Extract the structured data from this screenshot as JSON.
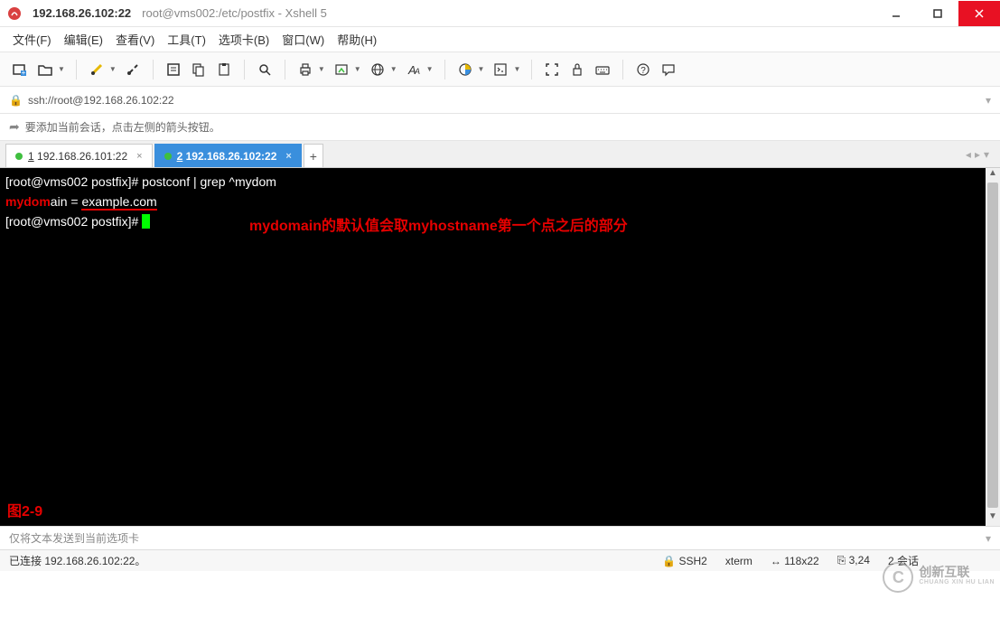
{
  "title": {
    "main": "192.168.26.102:22",
    "sub": "root@vms002:/etc/postfix - Xshell 5"
  },
  "menu": {
    "file": "文件(F)",
    "edit": "编辑(E)",
    "view": "查看(V)",
    "tools": "工具(T)",
    "tabs": "选项卡(B)",
    "window": "窗口(W)",
    "help": "帮助(H)"
  },
  "address": "ssh://root@192.168.26.102:22",
  "hint": "要添加当前会话，点击左侧的箭头按钮。",
  "tabs": {
    "items": [
      {
        "num": "1",
        "label": "192.168.26.101:22"
      },
      {
        "num": "2",
        "label": "192.168.26.102:22"
      }
    ]
  },
  "terminal": {
    "prompt": "[root@vms002 postfix]#",
    "cmd": " postconf | grep ^mydom",
    "out_key": "mydom",
    "out_rest": "ain = ",
    "out_val": "example.com",
    "annotation": "mydomain的默认值会取myhostname第一个点之后的部分",
    "figlabel": "图2-9"
  },
  "sendbar": "仅将文本发送到当前选项卡",
  "status": {
    "left": "已连接 192.168.26.102:22。",
    "ssh": "SSH2",
    "term": "xterm",
    "size": "118x22",
    "pos": "3,24",
    "sessions": "2 会话"
  },
  "watermark": {
    "name": "创新互联",
    "sub": "CHUANG XIN HU LIAN",
    "logo": "C"
  }
}
